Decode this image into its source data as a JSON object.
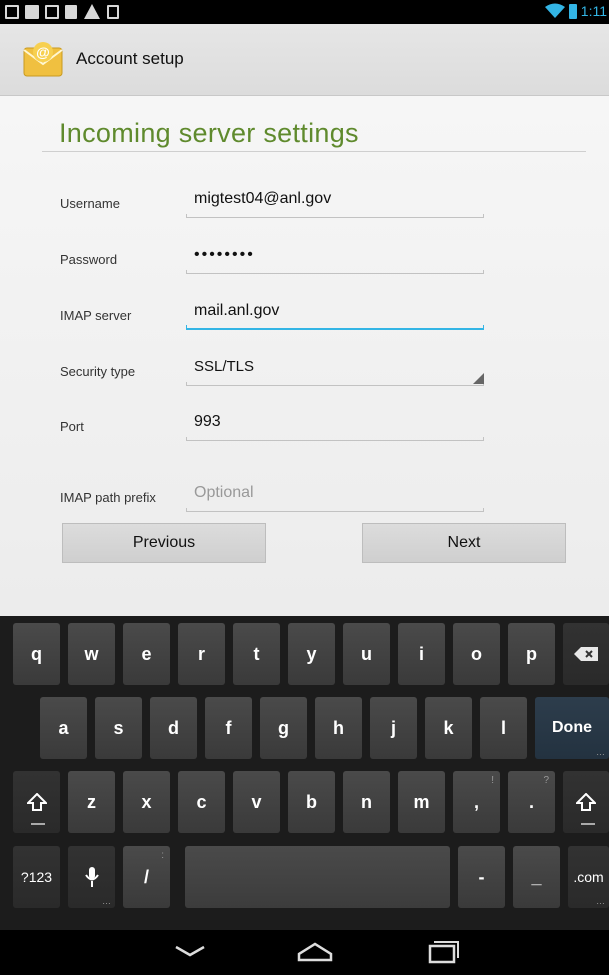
{
  "statusbar": {
    "time": "1:11"
  },
  "actionbar": {
    "title": "Account setup",
    "app_icon_glyph": "@"
  },
  "page": {
    "title": "Incoming server settings"
  },
  "form": {
    "username": {
      "label": "Username",
      "value": "migtest04@anl.gov"
    },
    "password": {
      "label": "Password",
      "value": "••••••••"
    },
    "imap_server": {
      "label": "IMAP server",
      "value": "mail.anl.gov"
    },
    "security_type": {
      "label": "Security type",
      "value": "SSL/TLS"
    },
    "port": {
      "label": "Port",
      "value": "993"
    },
    "imap_path_prefix": {
      "label": "IMAP path prefix",
      "placeholder": "Optional"
    }
  },
  "buttons": {
    "previous": "Previous",
    "next": "Next"
  },
  "keyboard": {
    "row1": [
      "q",
      "w",
      "e",
      "r",
      "t",
      "y",
      "u",
      "i",
      "o",
      "p"
    ],
    "row2": [
      "a",
      "s",
      "d",
      "f",
      "g",
      "h",
      "j",
      "k",
      "l"
    ],
    "row3": [
      "z",
      "x",
      "c",
      "v",
      "b",
      "n",
      "m",
      ",",
      "."
    ],
    "row3_hints": [
      "!",
      "?"
    ],
    "done": "Done",
    "symbols": "?123",
    "slash": "/",
    "dash": "-",
    "underscore": "_",
    "dotcom": ".com"
  },
  "colors": {
    "accent": "#33b5e5",
    "title_green": "#5f8a2d"
  }
}
